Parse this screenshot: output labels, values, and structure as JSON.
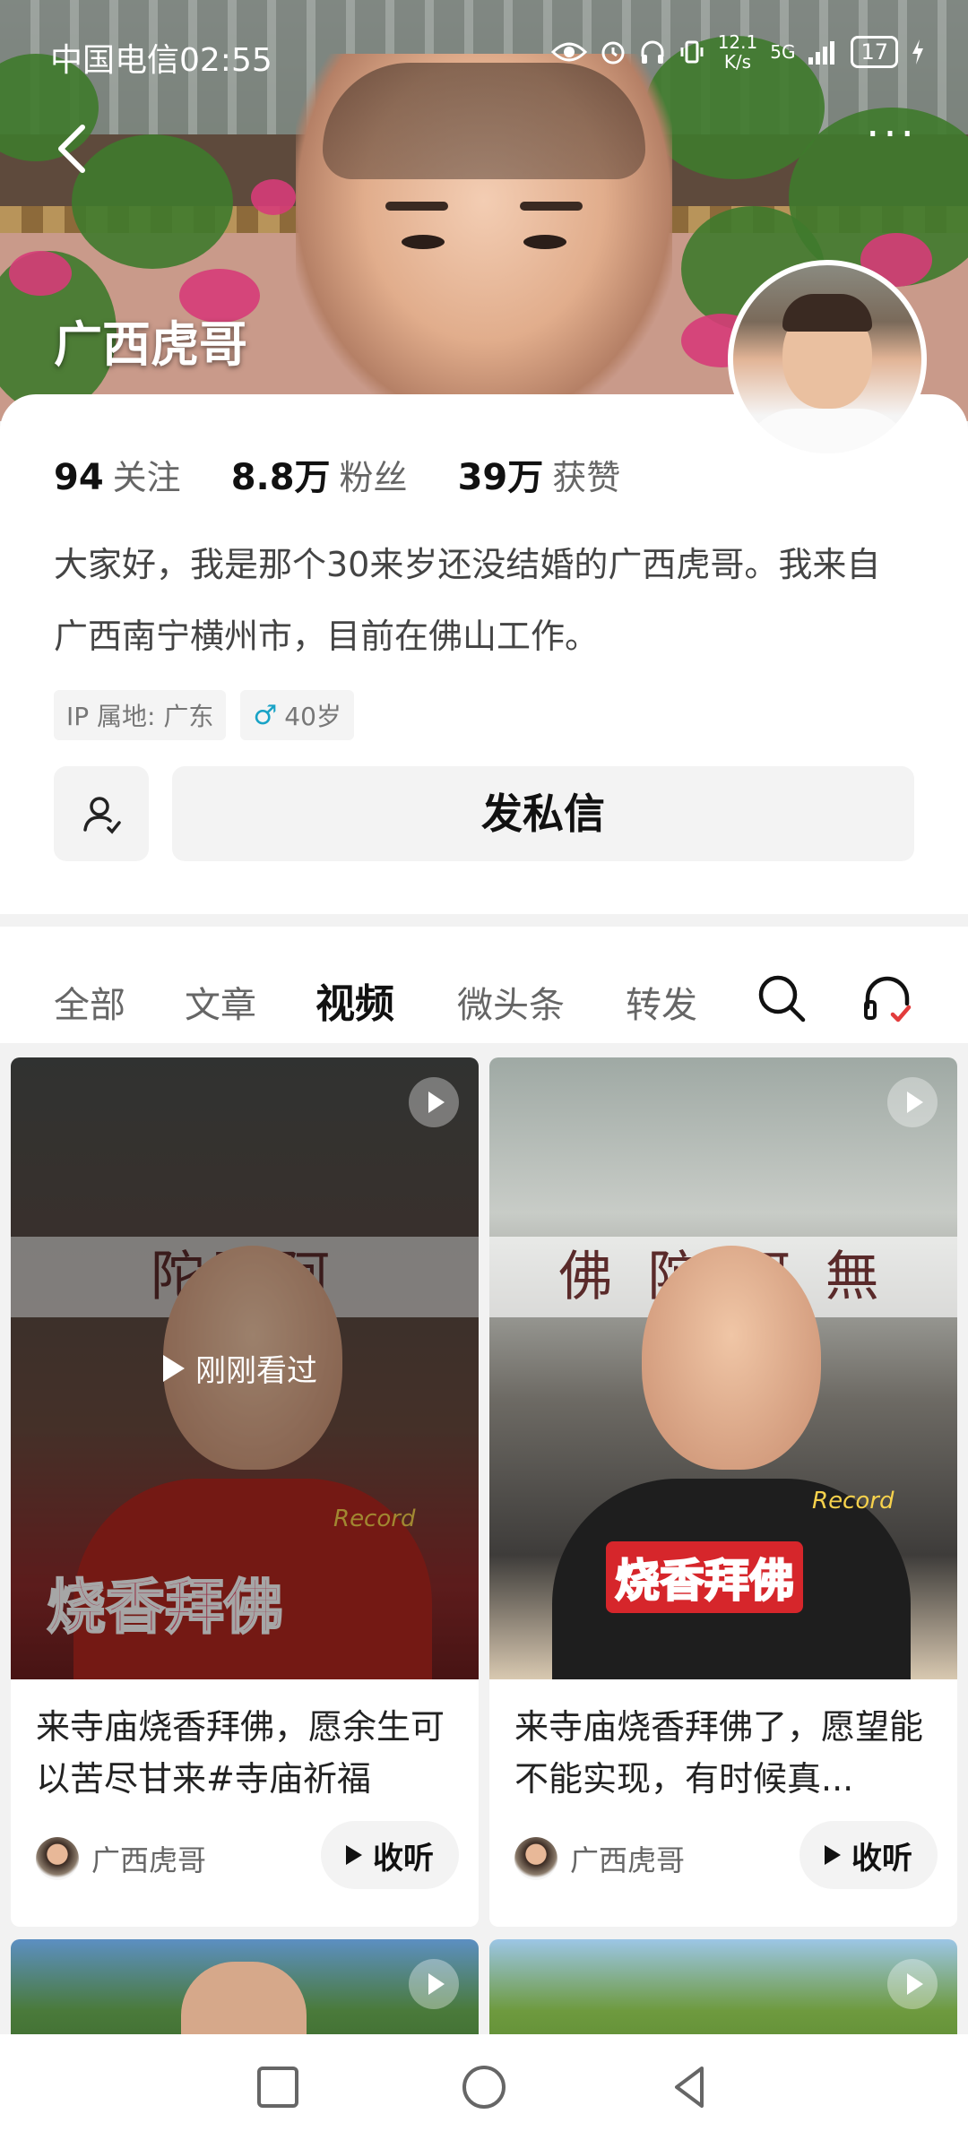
{
  "status": {
    "carrier_time": "中国电信02:55",
    "net_speed_value": "12.1",
    "net_speed_unit": "K/s",
    "signal": "5G",
    "battery": "17"
  },
  "banner": {
    "name": "广西虎哥"
  },
  "profile": {
    "stats": [
      {
        "num": "94",
        "label": "关注"
      },
      {
        "num": "8.8万",
        "label": "粉丝"
      },
      {
        "num": "39万",
        "label": "获赞"
      }
    ],
    "bio": "大家好，我是那个30来岁还没结婚的广西虎哥。我来自广西南宁横州市，目前在佛山工作。",
    "ip_tag": "IP 属地: 广东",
    "age_tag": "40岁",
    "dm_label": "发私信"
  },
  "tabs": [
    "全部",
    "文章",
    "视频",
    "微头条",
    "转发"
  ],
  "active_tab": "视频",
  "videos": [
    {
      "title": "来寺庙烧香拜佛，愿余生可以苦尽甘来#寺庙祈福",
      "author": "广西虎哥",
      "listen": "收听",
      "overlay": "刚刚看过",
      "art": "烧香拜佛",
      "rec": "Record",
      "sign": "陀彌阿"
    },
    {
      "title": "来寺庙烧香拜佛了，愿望能不能实现，有时候真...",
      "author": "广西虎哥",
      "listen": "收听",
      "art": "烧香拜佛",
      "rec": "Record",
      "sign": "佛 陀 阿 無"
    }
  ],
  "colors": {
    "accent_red": "#e23c3c",
    "male_blue": "#19a3c6"
  }
}
